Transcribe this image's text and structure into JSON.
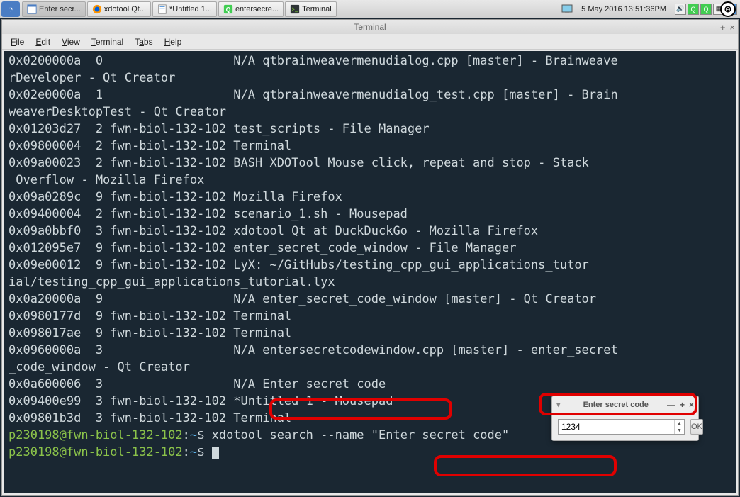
{
  "taskbar": {
    "tasks": [
      {
        "label": "Enter secr...",
        "active": true
      },
      {
        "label": "xdotool Qt..."
      },
      {
        "label": "*Untitled 1..."
      },
      {
        "label": "entersecre..."
      },
      {
        "label": "Terminal"
      }
    ],
    "clock": "5 May 2016 13:51:36PM"
  },
  "terminal": {
    "title": "Terminal",
    "menu": [
      "File",
      "Edit",
      "View",
      "Terminal",
      "Tabs",
      "Help"
    ],
    "lines": [
      "0x0200000a  0                  N/A qtbrainweavermenudialog.cpp [master] - Brainweave",
      "rDeveloper - Qt Creator",
      "0x02e0000a  1                  N/A qtbrainweavermenudialog_test.cpp [master] - Brain",
      "weaverDesktopTest - Qt Creator",
      "0x01203d27  2 fwn-biol-132-102 test_scripts - File Manager",
      "0x09800004  2 fwn-biol-132-102 Terminal",
      "0x09a00023  2 fwn-biol-132-102 BASH XDOTool Mouse click, repeat and stop - Stack",
      " Overflow - Mozilla Firefox",
      "0x09a0289c  9 fwn-biol-132-102 Mozilla Firefox",
      "0x09400004  2 fwn-biol-132-102 scenario_1.sh - Mousepad",
      "0x09a0bbf0  3 fwn-biol-132-102 xdotool Qt at DuckDuckGo - Mozilla Firefox",
      "0x012095e7  9 fwn-biol-132-102 enter_secret_code_window - File Manager",
      "0x09e00012  9 fwn-biol-132-102 LyX: ~/GitHubs/testing_cpp_gui_applications_tutor",
      "ial/testing_cpp_gui_applications_tutorial.lyx",
      "0x0a20000a  9                  N/A enter_secret_code_window [master] - Qt Creator",
      "0x0980177d  9 fwn-biol-132-102 Terminal",
      "0x098017ae  9 fwn-biol-132-102 Terminal",
      "0x0960000a  3                  N/A entersecretcodewindow.cpp [master] - enter_secret",
      "_code_window - Qt Creator",
      "0x0a600006  3                  N/A Enter secret code",
      "0x09400e99  3 fwn-biol-132-102 *Untitled 1 - Mousepad",
      "0x09801b3d  3 fwn-biol-132-102 Terminal"
    ],
    "prompt_user": "p230198@fwn-biol-132-102",
    "prompt_path": "~",
    "command1": "xdotool search --name \"Enter secret code\"",
    "command2": ""
  },
  "dialog": {
    "title": "Enter secret code",
    "value": "1234",
    "ok": "OK"
  }
}
